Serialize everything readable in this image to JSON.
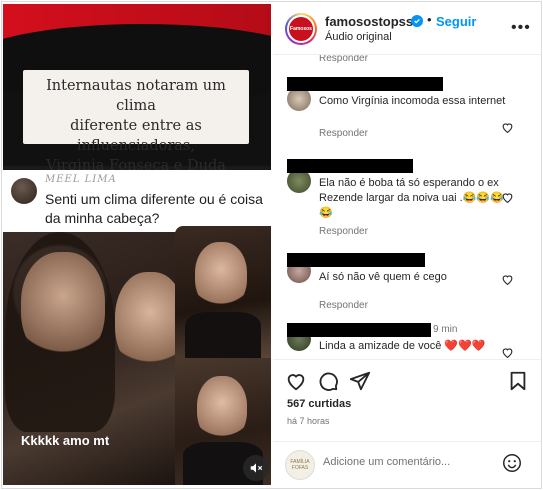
{
  "media": {
    "headline_lines": [
      "Internautas notaram um clima",
      "diferente entre as influenciadoras,",
      "Virginia Fonseca e Duda Freire."
    ],
    "tweet_handle": "MEEL LIMA",
    "tweet_text": "Senti um clima diferente ou é coisa da minha cabeça?",
    "caption": "Kkkkk amo mt"
  },
  "header": {
    "username": "famosostopsss",
    "follow_label": "Seguir",
    "audio_label": "Áudio original",
    "avatar_text": "Famosos",
    "more_icon": "more-options-icon"
  },
  "comments": {
    "top_reply_label": "Responder",
    "items": [
      {
        "text": "Como Virgínia incomoda essa internet",
        "reply": "Responder",
        "time": ""
      },
      {
        "text": "Ela não é boba tá só esperando o ex Rezende largar da noiva uai .😂😂😂😂",
        "reply": "Responder",
        "time": ""
      },
      {
        "text": "Aí só não vê quem é cego",
        "reply": "Responder",
        "time": ""
      },
      {
        "text": "Linda a amizade de você ❤️❤️❤️",
        "reply": "",
        "time": "9 min"
      }
    ]
  },
  "actions": {
    "likes": "567 curtidas",
    "time": "há 7 horas"
  },
  "add_comment": {
    "placeholder": "Adicione um comentário...",
    "avatar_text": "FAMÍLIA FOFAS"
  },
  "colors": {
    "accent": "#0095f6",
    "brand_red": "#c8101e"
  }
}
